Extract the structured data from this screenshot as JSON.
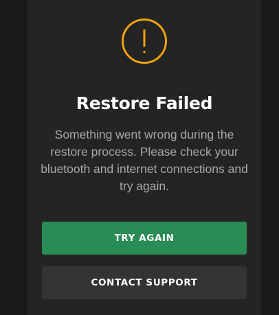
{
  "dialog": {
    "icon": "alert-circle-icon",
    "icon_color": "#f0a30a",
    "title": "Restore Failed",
    "message": "Something went wrong during the restore process. Please check your bluetooth and internet connections and try again."
  },
  "actions": {
    "primary_label": "TRY AGAIN",
    "primary_color": "#2a8c55",
    "secondary_label": "CONTACT SUPPORT",
    "secondary_color": "#333333"
  }
}
